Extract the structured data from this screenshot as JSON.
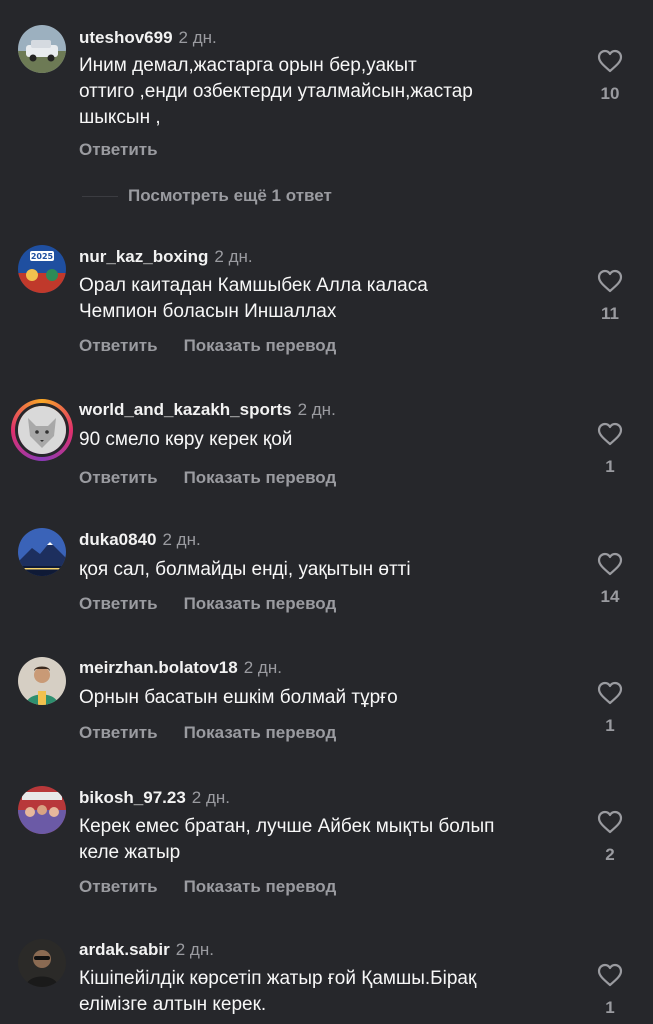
{
  "comments": [
    {
      "username": "uteshov699",
      "time": "2 дн.",
      "lines": [
        "Иним демал,жастарга орын бер,уакыт",
        "оттиго ,енди озбектерди уталмайсын,жастар",
        "шыксын ,"
      ],
      "reply_label": "Ответить",
      "likes": "10",
      "avatar_icon": "car-photo-avatar"
    },
    {
      "username": "nur_kaz_boxing",
      "time": "2 дн.",
      "lines": [
        "Орал каитадан Камшыбек Алла каласа",
        "Чемпион боласын Иншаллах"
      ],
      "reply_label": "Ответить",
      "translate_label": "Показать перевод",
      "likes": "11",
      "avatar_icon": "boxing-2025-avatar"
    },
    {
      "username": "world_and_kazakh_sports",
      "time": "2 дн.",
      "lines": [
        "90 смело көру керек қой"
      ],
      "reply_label": "Ответить",
      "translate_label": "Показать перевод",
      "likes": "1",
      "avatar_icon": "wolf-avatar"
    },
    {
      "username": "duka0840",
      "time": "2 дн.",
      "lines": [
        "қоя сал, болмайды енді, уақытын өтті"
      ],
      "reply_label": "Ответить",
      "translate_label": "Показать перевод",
      "likes": "14",
      "avatar_icon": "mountain-avatar"
    },
    {
      "username": "meirzhan.bolatov18",
      "time": "2 дн.",
      "lines": [
        "Орнын басатын ешкім болмай тұрғо"
      ],
      "reply_label": "Ответить",
      "translate_label": "Показать перевод",
      "likes": "1",
      "avatar_icon": "athlete-avatar"
    },
    {
      "username": "bikosh_97.23",
      "time": "2 дн.",
      "lines": [
        "Керек емес братан, лучше Айбек мықты болып",
        "келе жатыр"
      ],
      "reply_label": "Ответить",
      "translate_label": "Показать перевод",
      "likes": "2",
      "avatar_icon": "group-photo-avatar"
    },
    {
      "username": "ardak.sabir",
      "time": "2 дн.",
      "lines": [
        "Кішіпейілдік көрсетіп жатыр ғой Қамшы.Бірақ",
        "елімізге алтын керек."
      ],
      "likes": "1",
      "avatar_icon": "portrait-avatar"
    }
  ],
  "more_replies_label": "Посмотреть ещё 1 ответ",
  "colors": {
    "background": "#26272b",
    "primary_text": "#f7f7f7",
    "secondary_text": "#9a9ba0"
  }
}
